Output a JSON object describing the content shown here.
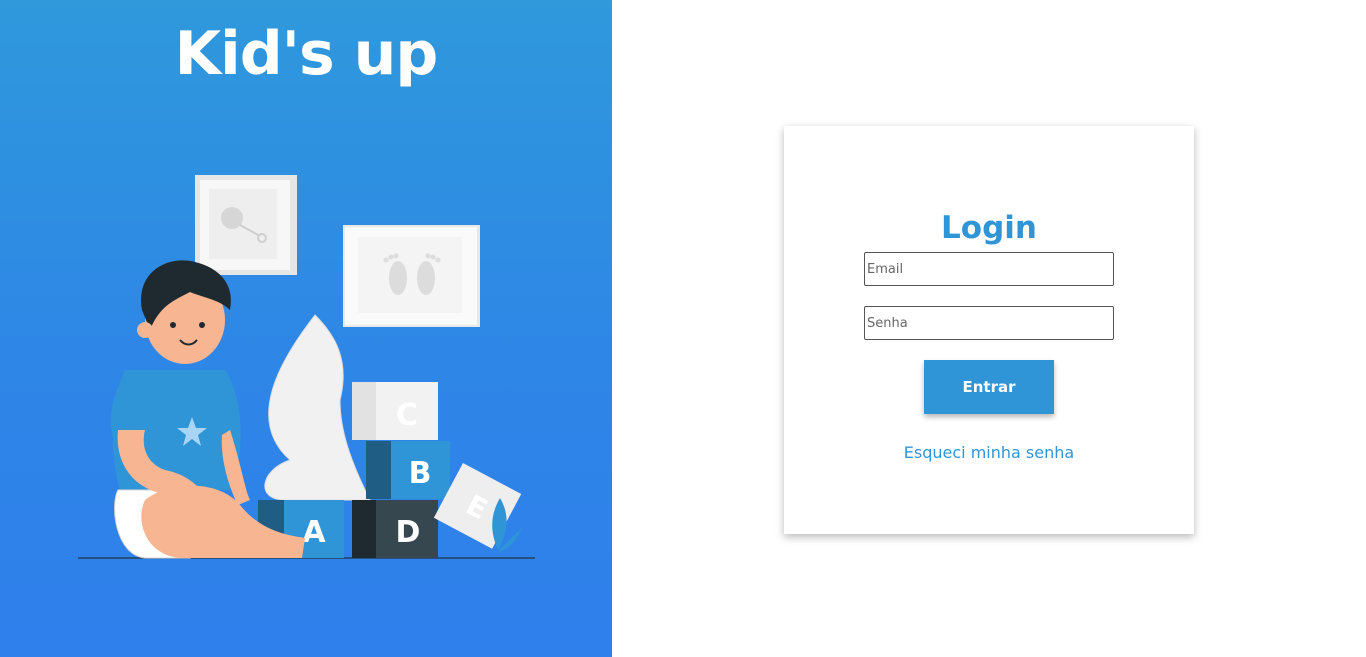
{
  "brand": {
    "title": "Kid's up"
  },
  "illustration": {
    "blocks": [
      "A",
      "B",
      "C",
      "D",
      "E"
    ]
  },
  "login": {
    "title": "Login",
    "email_placeholder": "Email",
    "password_placeholder": "Senha",
    "submit_label": "Entrar",
    "forgot_label": "Esqueci minha senha"
  },
  "colors": {
    "primary": "#2f95d7",
    "panel_gradient_top": "#2f99dc",
    "panel_gradient_bottom": "#2f7fec",
    "dark_block": "#37474f"
  }
}
